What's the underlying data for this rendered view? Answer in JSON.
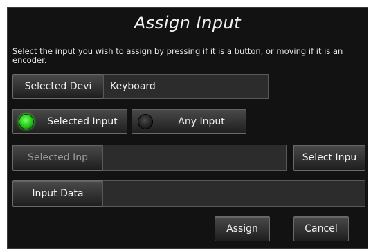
{
  "dialog": {
    "title": "Assign Input",
    "instructions": "Select the input you wish to assign by pressing if it is a button, or moving if it is an encoder.",
    "selected_device": {
      "button_label": "Selected Devi",
      "value": "Keyboard"
    },
    "toggles": {
      "selected_input": {
        "label": "Selected Input",
        "active": true
      },
      "any_input": {
        "label": "Any Input",
        "active": false
      }
    },
    "selected_input_row": {
      "button_label": "Selected Inp",
      "value": "",
      "select_button_label": "Select Inpu"
    },
    "input_data_row": {
      "button_label": "Input Data",
      "value": ""
    },
    "actions": {
      "assign_label": "Assign",
      "cancel_label": "Cancel"
    }
  },
  "colors": {
    "background": "#121212",
    "led_on": "#2fd41f",
    "led_off": "#1a1a1a"
  }
}
